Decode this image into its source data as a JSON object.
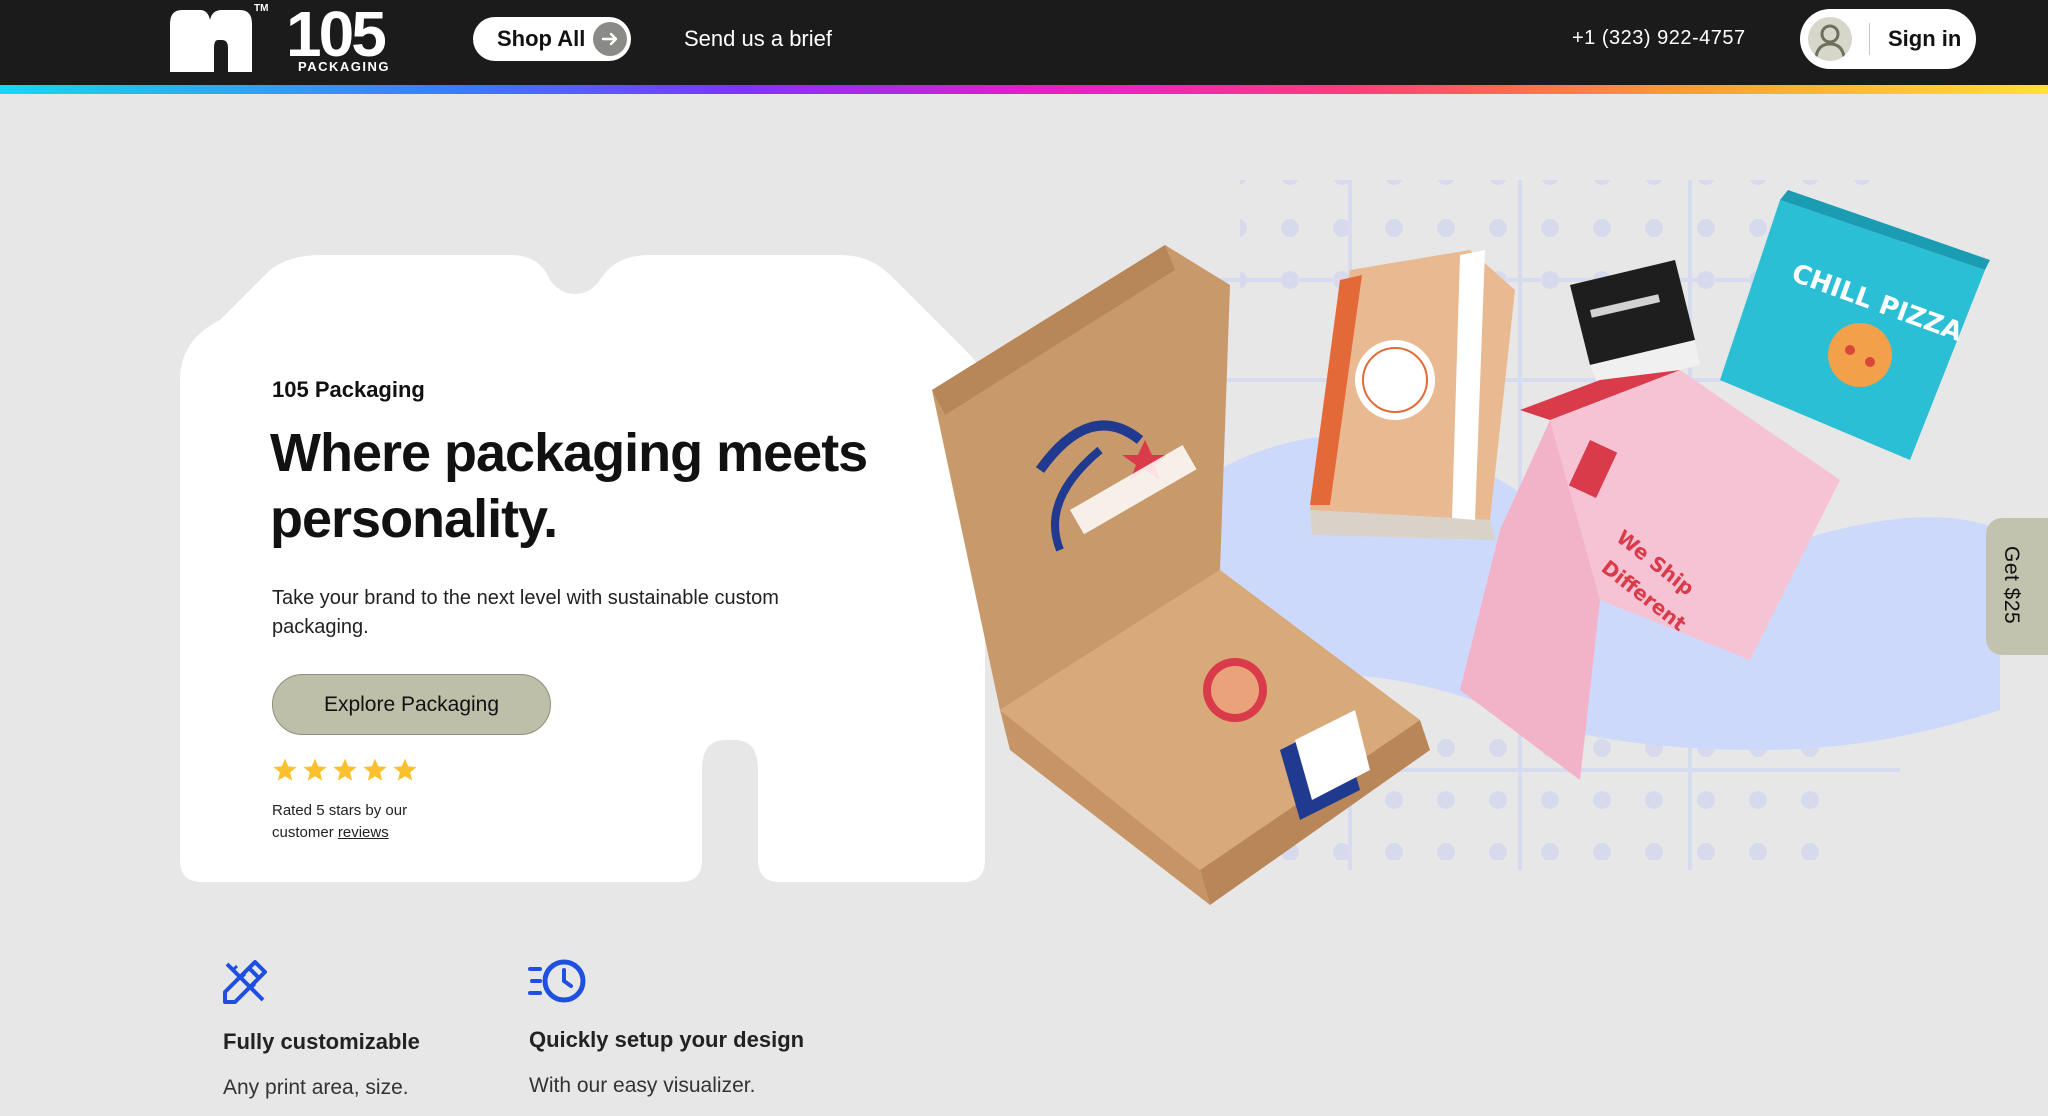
{
  "nav": {
    "logo_number": "105",
    "logo_sub": "PACKAGING",
    "logo_tm": "TM",
    "shop_all": "Shop All",
    "send_brief": "Send us a brief",
    "phone": "+1 (323) 922-4757",
    "sign_in": "Sign in"
  },
  "hero": {
    "kicker": "105 Packaging",
    "title": "Where packaging meets personality.",
    "description": "Take your brand to the next level with sustainable custom packaging.",
    "cta": "Explore Packaging",
    "rating_stars": 5,
    "rating_prefix": "Rated 5 stars by our customer",
    "rating_link": "reviews"
  },
  "side_tab": {
    "label": "Get $25"
  },
  "features": [
    {
      "icon": "pencil-ruler-icon",
      "title": "Fully customizable",
      "desc": "Any print area, size."
    },
    {
      "icon": "fast-clock-icon",
      "title": "Quickly setup your design",
      "desc": "With our easy visualizer."
    }
  ],
  "colors": {
    "nav_bg": "#1c1b1c",
    "page_bg": "#e7e7e8",
    "cta_bg": "#bebfa8",
    "accent_blue": "#1f4fe0",
    "star": "#fbc02d"
  }
}
